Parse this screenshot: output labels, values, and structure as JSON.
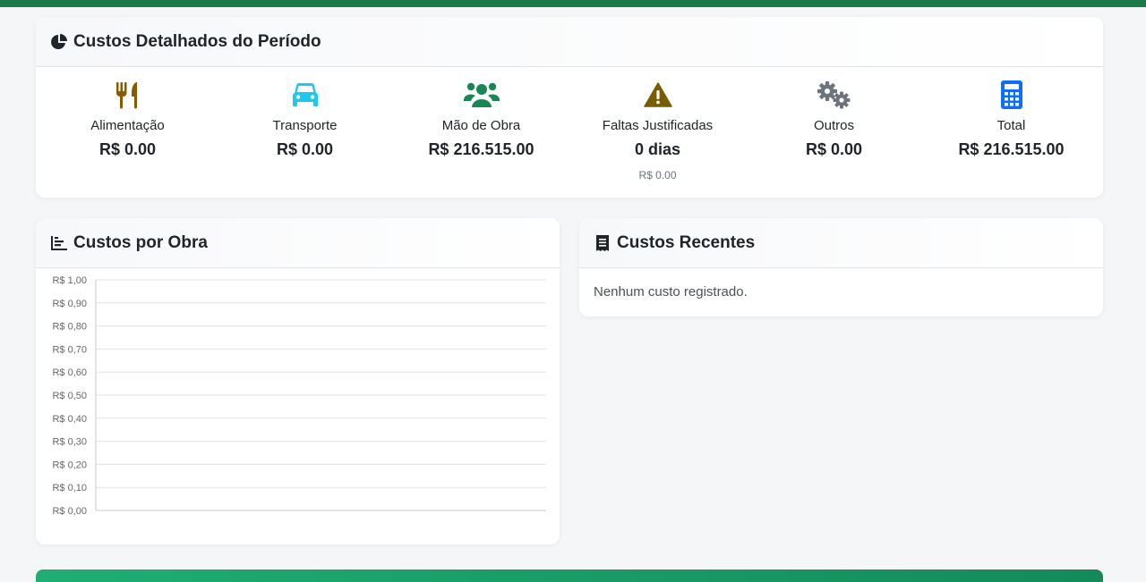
{
  "colors": {
    "top_bar": "#1b7a4a",
    "food": "#8a5a00",
    "transport": "#1ec8f0",
    "labor": "#198754",
    "absences": "#7a5c00",
    "others": "#6c757d",
    "total": "#0d6efd",
    "bottom_bar": "#1fae74"
  },
  "costs_card": {
    "title": "Custos Detalhados do Período",
    "icon": "pie-chart-icon",
    "items": [
      {
        "icon": "utensils-icon",
        "label": "Alimentação",
        "value": "R$ 0.00"
      },
      {
        "icon": "car-icon",
        "label": "Transporte",
        "value": "R$ 0.00"
      },
      {
        "icon": "users-icon",
        "label": "Mão de Obra",
        "value": "R$ 216.515.00"
      },
      {
        "icon": "warning-icon",
        "label": "Faltas Justificadas",
        "value": "0 dias",
        "sub": "R$ 0.00"
      },
      {
        "icon": "gears-icon",
        "label": "Outros",
        "value": "R$ 0.00"
      },
      {
        "icon": "calculator-icon",
        "label": "Total",
        "value": "R$ 216.515.00"
      }
    ]
  },
  "chart_card": {
    "title": "Custos por Obra",
    "icon": "chart-bar-icon"
  },
  "recent_card": {
    "title": "Custos Recentes",
    "icon": "receipt-icon",
    "empty_text": "Nenhum custo registrado."
  },
  "chart_data": {
    "type": "bar",
    "categories": [],
    "series": [],
    "ylim": [
      0,
      1
    ],
    "yticks": [
      1.0,
      0.9,
      0.8,
      0.7,
      0.6,
      0.5,
      0.4,
      0.3,
      0.2,
      0.1,
      0.0
    ],
    "ytick_labels": [
      "R$ 1,00",
      "R$ 0,90",
      "R$ 0,80",
      "R$ 0,70",
      "R$ 0,60",
      "R$ 0,50",
      "R$ 0,40",
      "R$ 0,30",
      "R$ 0,20",
      "R$ 0,10",
      "R$ 0,00"
    ],
    "grid": true
  }
}
